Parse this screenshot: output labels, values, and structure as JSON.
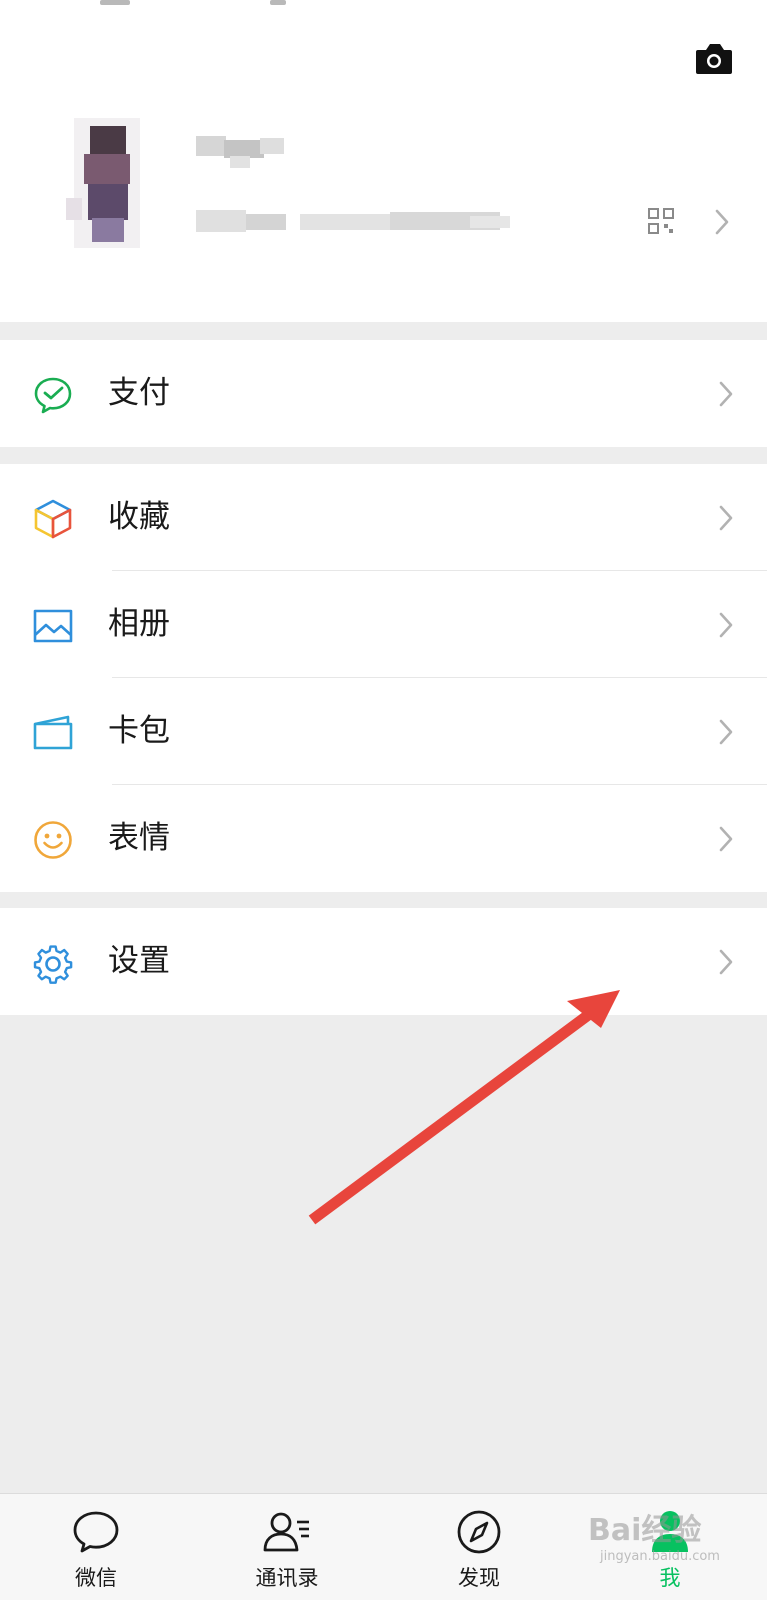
{
  "menu": {
    "pay": {
      "label": "支付",
      "icon": "wechat-pay-icon"
    },
    "favorites": {
      "label": "收藏",
      "icon": "cube-icon"
    },
    "album": {
      "label": "相册",
      "icon": "picture-icon"
    },
    "cards": {
      "label": "卡包",
      "icon": "card-wallet-icon"
    },
    "stickers": {
      "label": "表情",
      "icon": "smiley-icon"
    },
    "settings": {
      "label": "设置",
      "icon": "gear-icon"
    }
  },
  "tabbar": {
    "tabs": [
      {
        "label": "微信",
        "icon": "chat-bubble-icon",
        "active": false
      },
      {
        "label": "通讯录",
        "icon": "contacts-icon",
        "active": false
      },
      {
        "label": "发现",
        "icon": "compass-icon",
        "active": false
      },
      {
        "label": "我",
        "icon": "me-person-icon",
        "active": true
      }
    ]
  },
  "watermark": {
    "text": "Bai经验",
    "sub": "jingyan.baidu.com"
  },
  "colors": {
    "accent": "#07c160",
    "arrow": "#e8453c",
    "background": "#ededed"
  }
}
